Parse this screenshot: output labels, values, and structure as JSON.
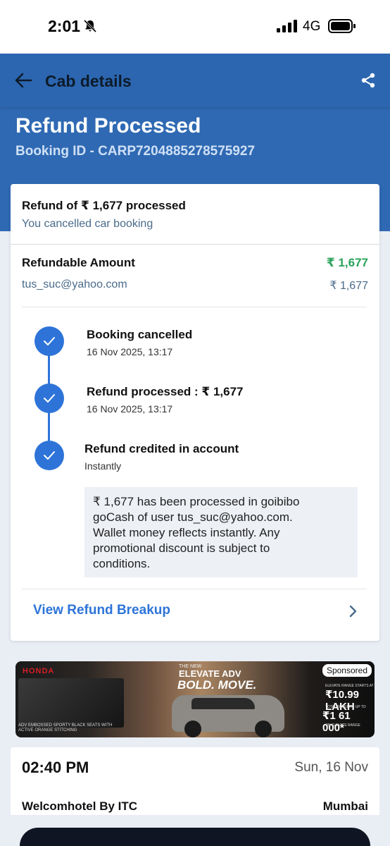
{
  "status_bar": {
    "time": "2:01",
    "network": "4G"
  },
  "header": {
    "title": "Cab details",
    "refund_title": "Refund Processed",
    "booking_id": "Booking ID - CARP7204885278575927"
  },
  "summary": {
    "refund_of": "Refund of ₹ 1,677 processed",
    "note": "You cancelled car booking"
  },
  "refundable": {
    "label": "Refundable Amount",
    "amount": "₹ 1,677",
    "email": "tus_suc@yahoo.com",
    "email_amount": "₹ 1,677"
  },
  "timeline": [
    {
      "title": "Booking cancelled",
      "sub": "16 Nov 2025, 13:17"
    },
    {
      "title": "Refund processed : ₹ 1,677",
      "sub": "16 Nov 2025, 13:17"
    },
    {
      "title": "Refund credited in account",
      "sub": "Instantly"
    }
  ],
  "info_box": {
    "line1": "₹ 1,677 has been processed in goibibo",
    "line2": "goCash  of user tus_suc@yahoo.com.",
    "line3": "Wallet money reflects instantly. Any",
    "line4": "promotional discount is subject to",
    "line5": "conditions."
  },
  "breakup_link": "View Refund Breakup",
  "ad": {
    "brand": "HONDA",
    "seats_text": "ADV EMBOSSED SPORTY BLACK SEATS WITH ACTIVE ORANGE STITCHING",
    "model_small": "THE NEW",
    "model": "ELEVATE ADV",
    "tagline": "BOLD. MOVE.",
    "sponsored": "Sponsored",
    "price_label": "ELEVATE RANGE STARTS AT",
    "price": "₹10.99 LAKH",
    "benefit_label": "TOTAL BENEFITS UP TO",
    "benefit": "₹1 61 000*",
    "benefit_sub": "ON ELEVATE RANGE"
  },
  "trip": {
    "time": "02:40 PM",
    "date": "Sun, 16 Nov",
    "hotel": "Welcomhotel By ITC",
    "city": "Mumbai"
  },
  "colors": {
    "header_blue": "#2f69b3",
    "accent_blue": "#2e74d8",
    "amount_green": "#2aa35a"
  }
}
